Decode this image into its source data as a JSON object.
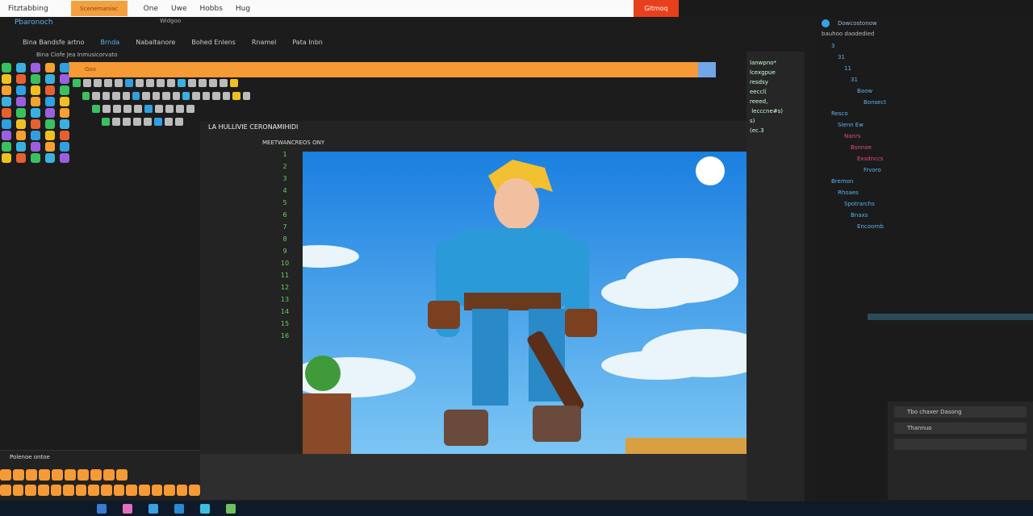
{
  "topbar": {
    "app_label": "Fitztabbing",
    "active_tab": "Scenemaniac",
    "menu": [
      "One",
      "Uwe",
      "Hobbs",
      "Hug"
    ],
    "action_button": "Gitmoq"
  },
  "app": {
    "title": "Pbaronoch",
    "window_title": "Widgoo"
  },
  "toolbar": {
    "items": [
      "Bina Bandsfe artno",
      "Brnda",
      "Nabaltanore",
      "Bohed Enlens",
      "Rnamel",
      "Pata Inbn"
    ]
  },
  "breadcrumb": "Bina Ciofe Jea Inmusicorvato",
  "orange_bar": {
    "label": "Goo"
  },
  "viewport": {
    "header": "LA HULLIVIE CERONAMIHIDI",
    "subheader": "MEETWANCREOS ONY",
    "line_numbers": [
      "1",
      "2",
      "3",
      "4",
      "5",
      "6",
      "7",
      "8",
      "9",
      "10",
      "11",
      "12",
      "13",
      "14",
      "15",
      "16"
    ]
  },
  "code_panel": {
    "lines": [
      "lanwpno*",
      "lcexgpue",
      "resdsy",
      "eeccl(",
      "reeed,",
      " lecccne#s)",
      "s)",
      "(ec.3"
    ]
  },
  "right_panel": {
    "header": "Dowcostonow",
    "sub": "bauhoo daodedied",
    "tree": [
      "3",
      "31",
      "11",
      "31",
      "Baow",
      "Bonsect",
      "Resco",
      "Sienn Ew",
      "Nanrs",
      "Bsnnoe",
      "Exsdnccs",
      "Frvoro",
      "Bremon",
      "Rhoaes",
      "Spotrarchs",
      "Bnaxs",
      "Encoornb"
    ],
    "props": [
      "Tbo chaxer Dasong",
      "Thannuo",
      ""
    ]
  },
  "bottom_left": {
    "title": "Polenoe ontoe"
  },
  "colors": {
    "accent_orange": "#f59a35",
    "accent_blue": "#5ab4f0",
    "action_red": "#e8401c"
  }
}
